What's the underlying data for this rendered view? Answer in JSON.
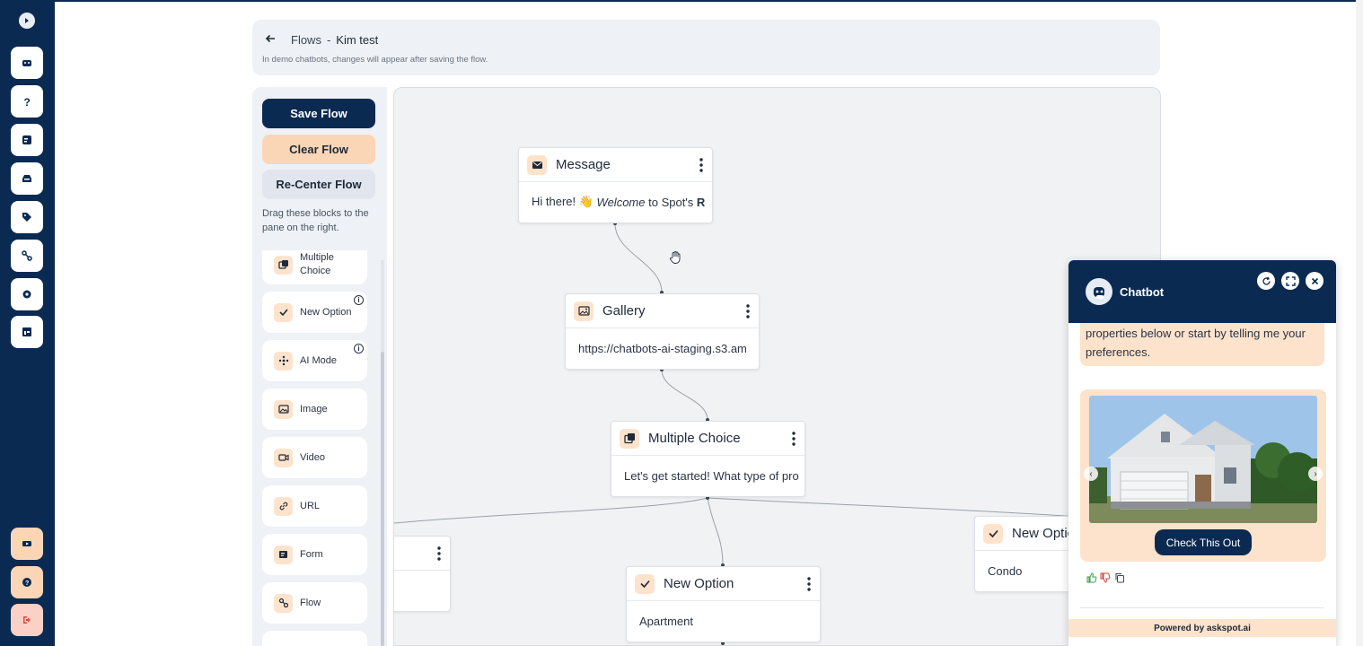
{
  "header": {
    "crumb_root": "Flows",
    "crumb_sep": "-",
    "crumb_page": "Kim test",
    "note": "In demo chatbots, changes will appear after saving the flow."
  },
  "panel": {
    "save_label": "Save Flow",
    "clear_label": "Clear Flow",
    "recenter_label": "Re-Center Flow",
    "hint": "Drag these blocks to the pane on the right.",
    "blocks": [
      {
        "label": "Multiple Choice",
        "icon": "cards-icon"
      },
      {
        "label": "New Option",
        "icon": "check-icon",
        "info": "i"
      },
      {
        "label": "AI Mode",
        "icon": "sparkle-icon",
        "info": "i"
      },
      {
        "label": "Image",
        "icon": "image-icon"
      },
      {
        "label": "Video",
        "icon": "video-icon"
      },
      {
        "label": "URL",
        "icon": "link-icon"
      },
      {
        "label": "Form",
        "icon": "form-icon"
      },
      {
        "label": "Flow",
        "icon": "flow-icon"
      }
    ]
  },
  "canvas": {
    "nodes": {
      "message": {
        "title": "Message",
        "text_before": "Hi there! 👋 ",
        "text_em": "Welcome",
        "text_after": " to Spot's ",
        "text_bold": "R"
      },
      "gallery": {
        "title": "Gallery",
        "text": "https://chatbots-ai-staging.s3.am"
      },
      "multiple_choice": {
        "title": "Multiple Choice",
        "text": "Let's get started! What type of pro"
      },
      "new_option_center": {
        "title": "New Option",
        "text": "Apartment"
      },
      "new_option_right": {
        "title": "New Optic",
        "text": "Condo"
      }
    }
  },
  "chatbot": {
    "title": "Chatbot",
    "message": "properties below or start by telling me your preferences.",
    "cta_label": "Check This Out",
    "footer": "Powered by askspot.ai"
  },
  "colors": {
    "navy": "#0b2a52",
    "peach": "#fbd6b6",
    "peach_light": "#fde3cc",
    "canvas_bg": "#f1f2f4"
  }
}
